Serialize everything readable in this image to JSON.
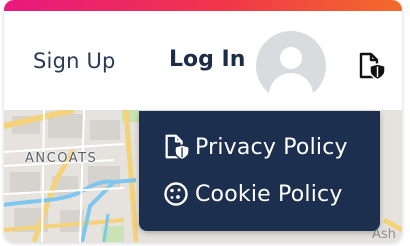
{
  "header": {
    "signup_label": "Sign Up",
    "login_label": "Log In",
    "avatar_icon": "user-avatar-icon",
    "privacy_icon": "document-shield-icon"
  },
  "map": {
    "district_label": "ANCOATS",
    "partial_label": "Ash"
  },
  "dropdown": {
    "items": [
      {
        "label": "Privacy Policy",
        "icon": "document-shield-icon"
      },
      {
        "label": "Cookie Policy",
        "icon": "cookie-icon"
      }
    ]
  },
  "colors": {
    "accent_start": "#e8197f",
    "accent_end": "#f26b2a",
    "menu_bg": "#1d2f4f",
    "text_dark": "#1d2d47"
  }
}
